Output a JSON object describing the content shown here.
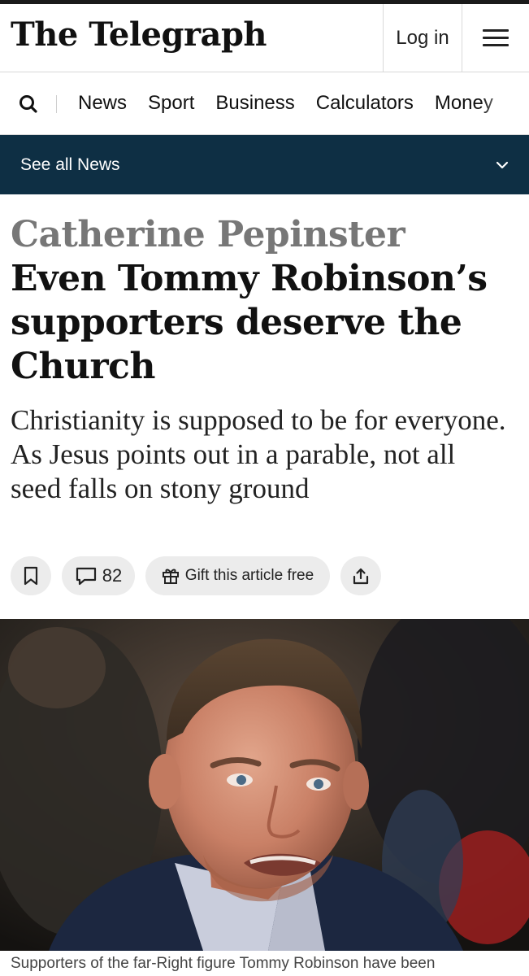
{
  "header": {
    "logo": "The Telegraph",
    "login_label": "Log in",
    "menu_icon": "hamburger-icon"
  },
  "nav": {
    "search_icon": "search-icon",
    "items": [
      "News",
      "Sport",
      "Business",
      "Calculators",
      "Money"
    ]
  },
  "section_bar": {
    "label": "See all News",
    "icon": "chevron-down-icon",
    "background": "#0e2f44"
  },
  "article": {
    "author": "Catherine Pepinster",
    "headline": "Even Tommy Robinson’s supporters deserve the Church",
    "standfirst": "Christianity is supposed to be for everyone. As Jesus points out in a parable, not all seed falls on stony ground",
    "actions": {
      "bookmark_icon": "bookmark-icon",
      "comments_icon": "comment-icon",
      "comments_count": "82",
      "gift_icon": "gift-icon",
      "gift_label": "Gift this article free",
      "share_icon": "share-icon"
    },
    "image_caption": "Supporters of the far-Right figure Tommy Robinson have been"
  }
}
